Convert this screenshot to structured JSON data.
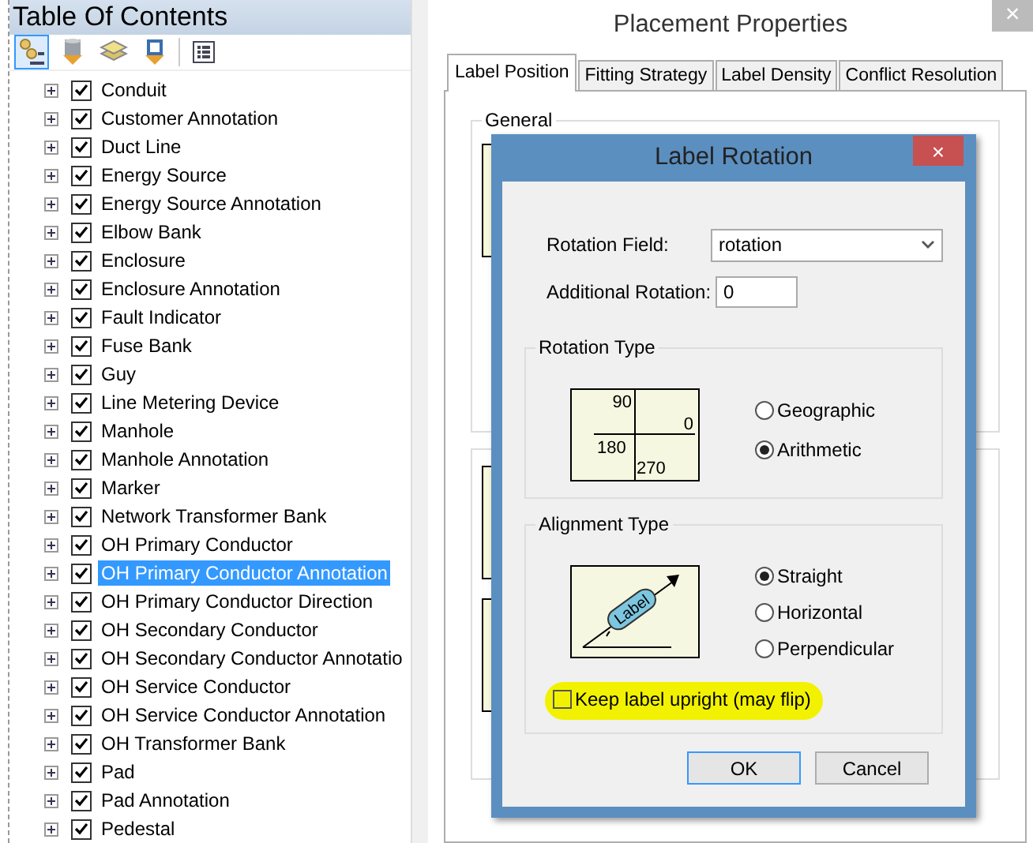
{
  "toc": {
    "title": "Table Of Contents",
    "tools": [
      {
        "kind": "drawing-order",
        "selected": true
      },
      {
        "kind": "source",
        "selected": false
      },
      {
        "kind": "visibility",
        "selected": false
      },
      {
        "kind": "selection",
        "selected": false
      },
      {
        "kind": "options",
        "selected": false
      }
    ],
    "layers": [
      {
        "label": "Conduit",
        "checked": true,
        "selected": false
      },
      {
        "label": "Customer Annotation",
        "checked": true,
        "selected": false
      },
      {
        "label": "Duct Line",
        "checked": true,
        "selected": false
      },
      {
        "label": "Energy Source",
        "checked": true,
        "selected": false
      },
      {
        "label": "Energy Source Annotation",
        "checked": true,
        "selected": false
      },
      {
        "label": "Elbow Bank",
        "checked": true,
        "selected": false
      },
      {
        "label": "Enclosure",
        "checked": true,
        "selected": false
      },
      {
        "label": "Enclosure Annotation",
        "checked": true,
        "selected": false
      },
      {
        "label": "Fault Indicator",
        "checked": true,
        "selected": false
      },
      {
        "label": "Fuse Bank",
        "checked": true,
        "selected": false
      },
      {
        "label": "Guy",
        "checked": true,
        "selected": false
      },
      {
        "label": "Line Metering Device",
        "checked": true,
        "selected": false
      },
      {
        "label": "Manhole",
        "checked": true,
        "selected": false
      },
      {
        "label": "Manhole Annotation",
        "checked": true,
        "selected": false
      },
      {
        "label": "Marker",
        "checked": true,
        "selected": false
      },
      {
        "label": "Network Transformer Bank",
        "checked": true,
        "selected": false
      },
      {
        "label": "OH Primary Conductor",
        "checked": true,
        "selected": false
      },
      {
        "label": "OH Primary Conductor Annotation",
        "checked": true,
        "selected": true
      },
      {
        "label": "OH Primary Conductor Direction",
        "checked": true,
        "selected": false
      },
      {
        "label": "OH Secondary Conductor",
        "checked": true,
        "selected": false
      },
      {
        "label": "OH Secondary Conductor Annotatio",
        "checked": true,
        "selected": false
      },
      {
        "label": "OH Service Conductor",
        "checked": true,
        "selected": false
      },
      {
        "label": "OH Service Conductor Annotation",
        "checked": true,
        "selected": false
      },
      {
        "label": "OH Transformer Bank",
        "checked": true,
        "selected": false
      },
      {
        "label": "Pad",
        "checked": true,
        "selected": false
      },
      {
        "label": "Pad Annotation",
        "checked": true,
        "selected": false
      },
      {
        "label": "Pedestal",
        "checked": true,
        "selected": false
      }
    ]
  },
  "placement": {
    "title": "Placement Properties",
    "close": "×",
    "tabs": [
      {
        "label": "Label Position",
        "selected": true
      },
      {
        "label": "Fitting Strategy",
        "selected": false
      },
      {
        "label": "Label Density",
        "selected": false
      },
      {
        "label": "Conflict Resolution",
        "selected": false
      }
    ],
    "general_group": {
      "title": "General"
    }
  },
  "dialog": {
    "title": "Label Rotation",
    "close": "×",
    "rotation_field": {
      "label": "Rotation Field:",
      "value": "rotation"
    },
    "additional_rotation": {
      "label": "Additional Rotation:",
      "value": "0"
    },
    "rotation_type": {
      "title": "Rotation Type",
      "diagram_labels": [
        "90",
        "0",
        "180",
        "270"
      ],
      "options": [
        {
          "label": "Geographic",
          "selected": false
        },
        {
          "label": "Arithmetic",
          "selected": true
        }
      ]
    },
    "alignment_type": {
      "title": "Alignment Type",
      "diagram_label": "Label",
      "options": [
        {
          "label": "Straight",
          "selected": true
        },
        {
          "label": "Horizontal",
          "selected": false
        },
        {
          "label": "Perpendicular",
          "selected": false
        }
      ],
      "keep_upright": {
        "label": "Keep label upright (may flip)",
        "checked": false,
        "highlighted": true
      }
    },
    "buttons": [
      {
        "label": "OK",
        "default": true
      },
      {
        "label": "Cancel",
        "default": false
      }
    ]
  }
}
